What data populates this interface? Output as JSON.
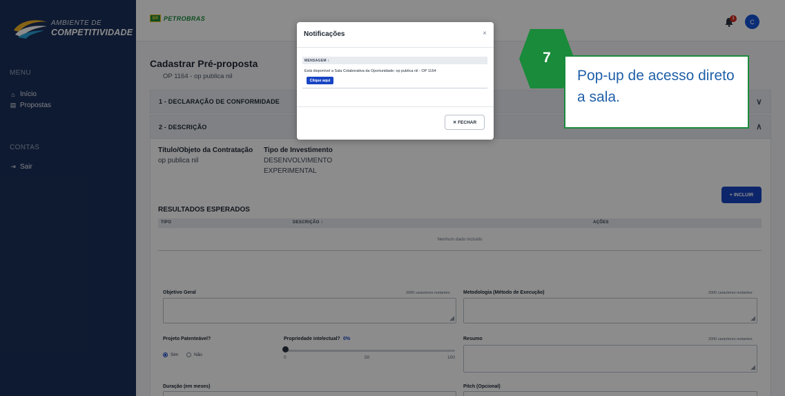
{
  "sidebar": {
    "logo_top": "AMBIENTE DE",
    "logo_bottom": "COMPETITIVIDADE",
    "menu_label": "MENU",
    "items": [
      {
        "label": "Início",
        "icon": "home-icon"
      },
      {
        "label": "Propostas",
        "icon": "document-icon"
      }
    ],
    "accounts_label": "CONTAS",
    "logout_label": "Sair"
  },
  "topbar": {
    "brand": "PETROBRAS",
    "brand_mark": "BR",
    "notification_count": "1",
    "avatar_initial": "C"
  },
  "page": {
    "title": "Cadastrar Pré-proposta",
    "subtitle": "OP 1164 - op publica nil"
  },
  "sections": [
    {
      "label": "1 - DECLARAÇÃO DE CONFORMIDADE"
    },
    {
      "label": "2 - DESCRIÇÃO"
    }
  ],
  "description": {
    "title_label": "Título/Objeto da Contratação",
    "title_value": "op publica nil",
    "investment_label": "Tipo de Investimento",
    "investment_value_line1": "DESENVOLVIMENTO",
    "investment_value_line2": "EXPERIMENTAL",
    "include_button": "+ INCLUIR",
    "results_title": "RESULTADOS ESPERADOS",
    "table_headers": [
      "TIPO",
      "DESCRIÇÃO ↕",
      "AÇÕES"
    ],
    "empty_text": "Nenhum dado incluído",
    "objetivo_label": "Objetivo Geral",
    "objetivo_count": "2000 caracteres restantes",
    "metodologia_label": "Metodologia (Método de Execução)",
    "metodologia_count": "2000 caracteres restantes",
    "patente_label": "Projeto Patenteável?",
    "radio_yes": "Sim",
    "radio_no": "Não",
    "pi_label": "Propriedade intelectual?",
    "pi_value": "0%",
    "slider_ticks": [
      "0",
      "50",
      "100"
    ],
    "resumo_label": "Resumo",
    "resumo_count": "2000 caracteres restantes",
    "duracao_label": "Duração (em meses)",
    "pitch_label": "Pitch (Opcional)"
  },
  "modal": {
    "title": "Notificações",
    "close_symbol": "×",
    "column_header": "MENSAGEM ↕",
    "message": "Está disponível a Sala Colaborativa da Oportunidade: op publica nil - OP 1164",
    "message_button": "Clique aqui",
    "close_button": "✕ FECHAR"
  },
  "callout": {
    "number": "7",
    "text": "Pop-up de acesso direto a sala."
  },
  "colors": {
    "sidebar": "#1a3159",
    "primary": "#1845c4",
    "callout_green": "#1a8a3b",
    "callout_text": "#1f5fa8"
  }
}
